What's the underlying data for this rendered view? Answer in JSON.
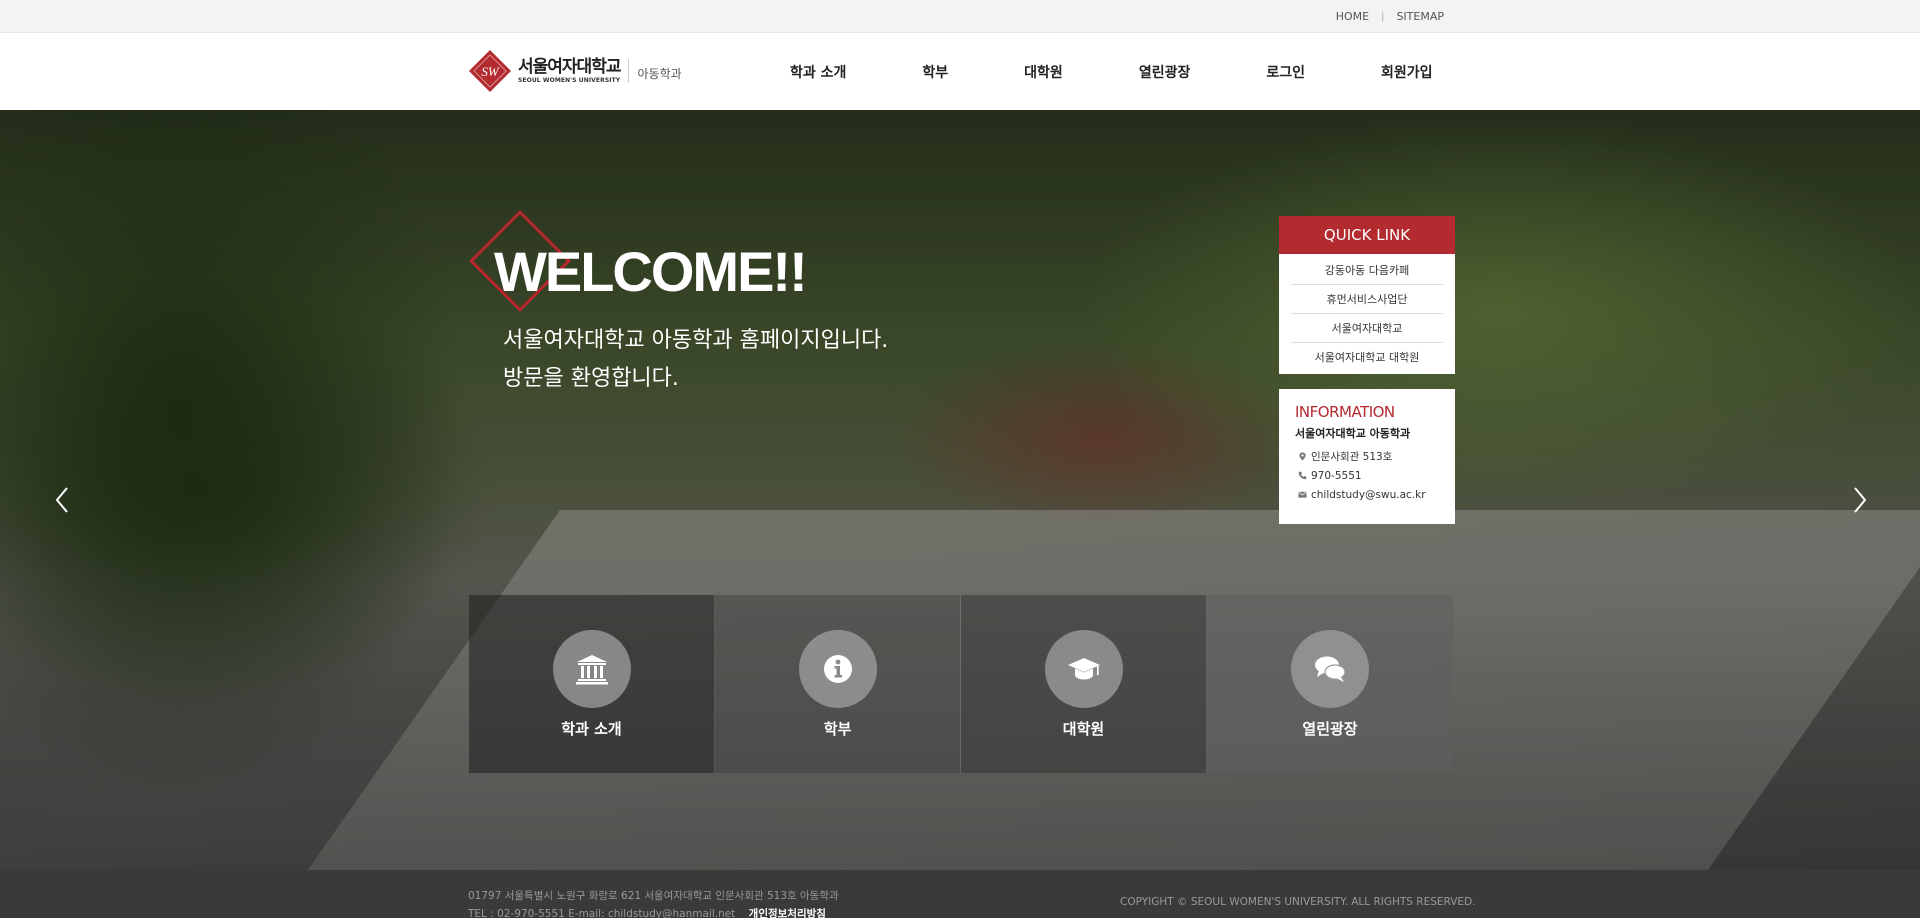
{
  "util": {
    "home": "HOME",
    "sep": "|",
    "sitemap": "SITEMAP"
  },
  "header": {
    "logo_ko": "서울여자대학교",
    "logo_en": "SEOUL WOMEN'S UNIVERSITY",
    "logo_mark": "SW",
    "dept": "아동학과",
    "nav": [
      "학과 소개",
      "학부",
      "대학원",
      "열린광장",
      "로그인",
      "회원가입"
    ]
  },
  "hero": {
    "title": "WELCOME!!",
    "sub1": "서울여자대학교 아동학과 홈페이지입니다.",
    "sub2": "방문을 환영합니다."
  },
  "quick": {
    "title": "QUICK LINK",
    "links": [
      "강동아동 다음카페",
      "휴먼서비스사업단",
      "서울여자대학교",
      "서울여자대학교 대학원"
    ]
  },
  "info": {
    "title": "INFORMATION",
    "dept": "서울여자대학교 아동학과",
    "location": "인문사회관 513호",
    "phone": "970-5551",
    "email": "childstudy@swu.ac.kr"
  },
  "boxes": [
    {
      "label": "학과 소개",
      "icon": "building-icon"
    },
    {
      "label": "학부",
      "icon": "info-icon"
    },
    {
      "label": "대학원",
      "icon": "graduation-cap-icon"
    },
    {
      "label": "열린광장",
      "icon": "chat-bubbles-icon"
    }
  ],
  "footer": {
    "address": "01797 서울특별시 노원구 화랑로 621 서울여자대학교 인문사회관 513호 아동학과",
    "contact": "TEL : 02-970-5551    E-mail: childstudy@hanmail.net",
    "privacy": "개인정보처리방침",
    "copyright": "COPYIGHT © SEOUL WOMEN'S UNIVERSITY. ALL RIGHTS RESERVED."
  },
  "colors": {
    "accent": "#b32a2f",
    "footer_bg": "#3a3a3a",
    "util_bg": "#f3f3f3"
  }
}
